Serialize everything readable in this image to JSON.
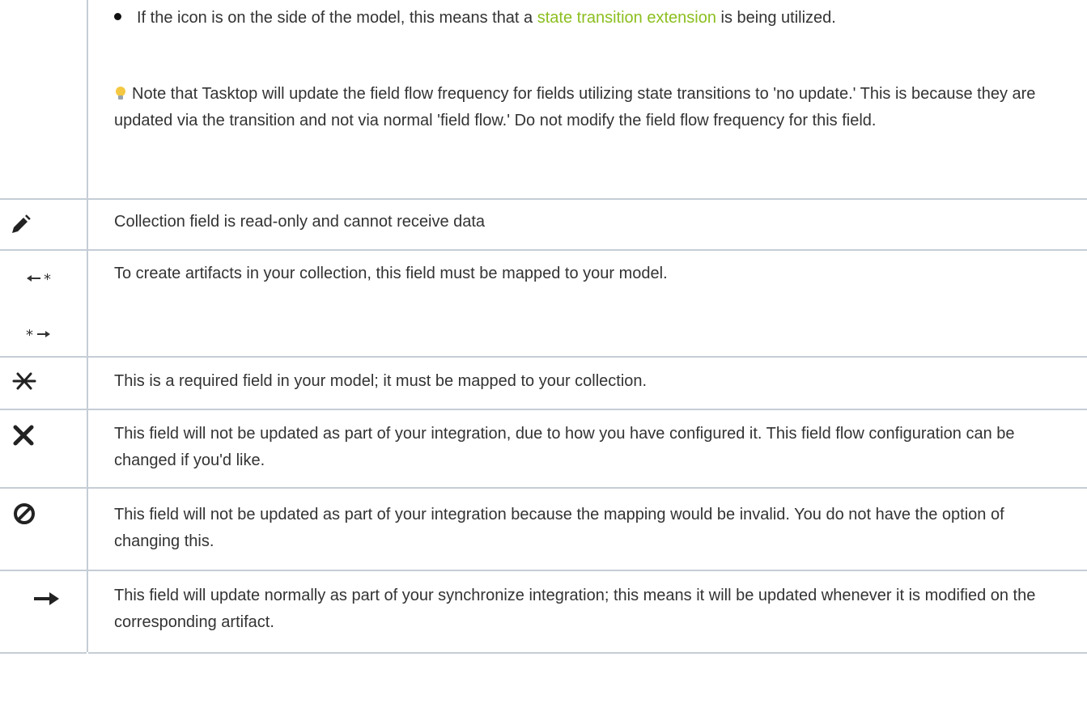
{
  "intro": {
    "bullet_before_link": "If the icon is on the side of the model, this means that a ",
    "bullet_link": "state transition extension",
    "bullet_after_link": " is being utilized.",
    "note": "Note that Tasktop will update the field flow frequency for fields utilizing state transitions to 'no update.' This is because they are updated via the transition and not via normal 'field flow.' Do not modify the field flow frequency for this field.",
    "note_icon": "lightbulb-icon"
  },
  "rows": [
    {
      "icon": "pencil-slash-icon",
      "text": "Collection field is read-only and cannot receive data"
    },
    {
      "icon": "arrow-asterisk-icon",
      "text": "To create artifacts in your collection, this field must be mapped to your model."
    },
    {
      "icon": "asterisk-icon",
      "text": "This is a required field in your model; it must be mapped to your collection."
    },
    {
      "icon": "x-icon",
      "text": "This field will not be updated as part of your integration, due to how you have configured it. This field flow configuration can be changed if you'd like."
    },
    {
      "icon": "prohibited-icon",
      "text": "This field will not be updated as part of your integration because the mapping would be invalid. You do not have the option of changing this."
    },
    {
      "icon": "arrow-right-icon",
      "text": "This field will update normally as part of your synchronize integration; this means it will be updated whenever it is modified on the corresponding artifact."
    }
  ],
  "colors": {
    "link": "#8cbf1f",
    "border": "#c5cdd6",
    "text": "#333333"
  }
}
